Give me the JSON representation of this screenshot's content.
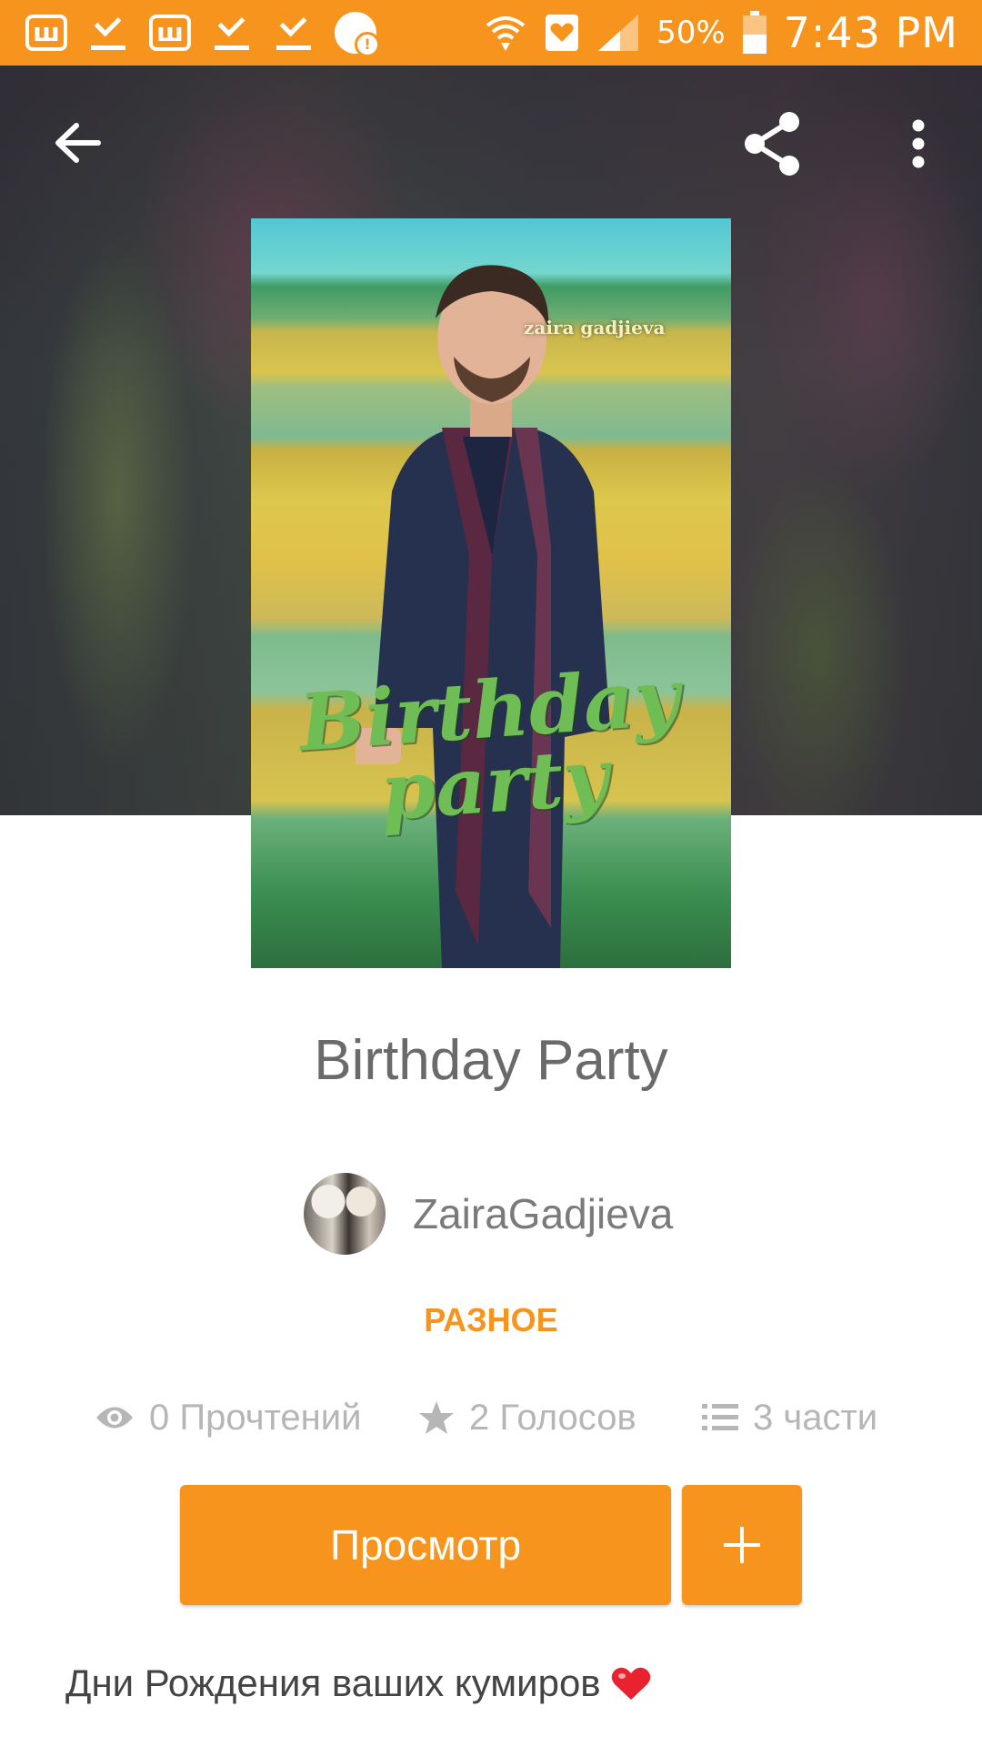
{
  "status_bar": {
    "battery_percent": "50%",
    "time": "7:43 PM",
    "left_icons": [
      "wattpad-icon",
      "download-done-icon",
      "wattpad-icon",
      "download-done-icon",
      "download-done-icon",
      "alert-icon"
    ],
    "right_icons": [
      "wifi-icon",
      "heart-icon",
      "signal-icon",
      "battery-icon"
    ]
  },
  "toolbar": {
    "icons": [
      "back-arrow-icon",
      "share-icon",
      "more-vert-icon"
    ]
  },
  "cover": {
    "credit": "zaira gadjieva",
    "title": "Birthday party"
  },
  "story": {
    "title": "Birthday Party",
    "author": "ZairaGadjieva",
    "category": "РАЗНОЕ",
    "stats": {
      "reads": "0 Прочтений",
      "votes": "2 Голосов",
      "parts": "3 части"
    },
    "view_button": "Просмотр",
    "add_button": "+",
    "description": "Дни Рождения ваших кумиров"
  },
  "colors": {
    "accent": "#f7941d",
    "title_text": "#6a6a6a",
    "stat_text": "#b6b6b6"
  }
}
